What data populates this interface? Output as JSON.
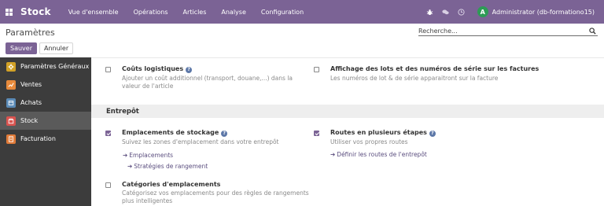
{
  "navbar": {
    "app_name": "Stock",
    "menu": [
      "Vue d'ensemble",
      "Opérations",
      "Articles",
      "Analyse",
      "Configuration"
    ],
    "avatar_initial": "A",
    "user": "Administrator (db-formationo15)",
    "icons": [
      "apps-icon",
      "bug-icon",
      "chat-icon",
      "clock-icon"
    ]
  },
  "control": {
    "title": "Paramètres",
    "search_placeholder": "Recherche...",
    "save_label": "Sauver",
    "cancel_label": "Annuler"
  },
  "sidebar": {
    "items": [
      {
        "label": "Paramètres Généraux",
        "icon": "gear-icon",
        "color": "#d1a126"
      },
      {
        "label": "Ventes",
        "icon": "chart-icon",
        "color": "#e88a3b"
      },
      {
        "label": "Achats",
        "icon": "purchase-icon",
        "color": "#5b8bb7"
      },
      {
        "label": "Stock",
        "icon": "box-icon",
        "color": "#d9534f"
      },
      {
        "label": "Facturation",
        "icon": "invoice-icon",
        "color": "#e07b39"
      }
    ],
    "active": "Stock"
  },
  "main": {
    "top_left": {
      "title": "Coûts logistiques",
      "desc": "Ajouter un coût additionnel (transport, douane,...) dans la valeur de l'article",
      "checked": false
    },
    "top_right": {
      "title": "Affichage des lots et des numéros de série sur les factures",
      "desc": "Les numéros de lot & de série apparaitront sur la facture",
      "checked": false
    },
    "section": "Entrepôt",
    "storage": {
      "title": "Emplacements de stockage",
      "desc": "Suivez les zones d'emplacement dans votre entrepôt",
      "links": [
        "Emplacements",
        "Stratégies de rangement"
      ],
      "checked": true
    },
    "routes": {
      "title": "Routes en plusieurs étapes",
      "desc": "Utiliser vos propres routes",
      "links": [
        "Définir les routes de l'entrepôt"
      ],
      "checked": true
    },
    "categories": {
      "title": "Catégories d'emplacements",
      "desc": "Catégorisez vos emplacements pour des règles de rangements plus intelligentes",
      "checked": false
    }
  }
}
